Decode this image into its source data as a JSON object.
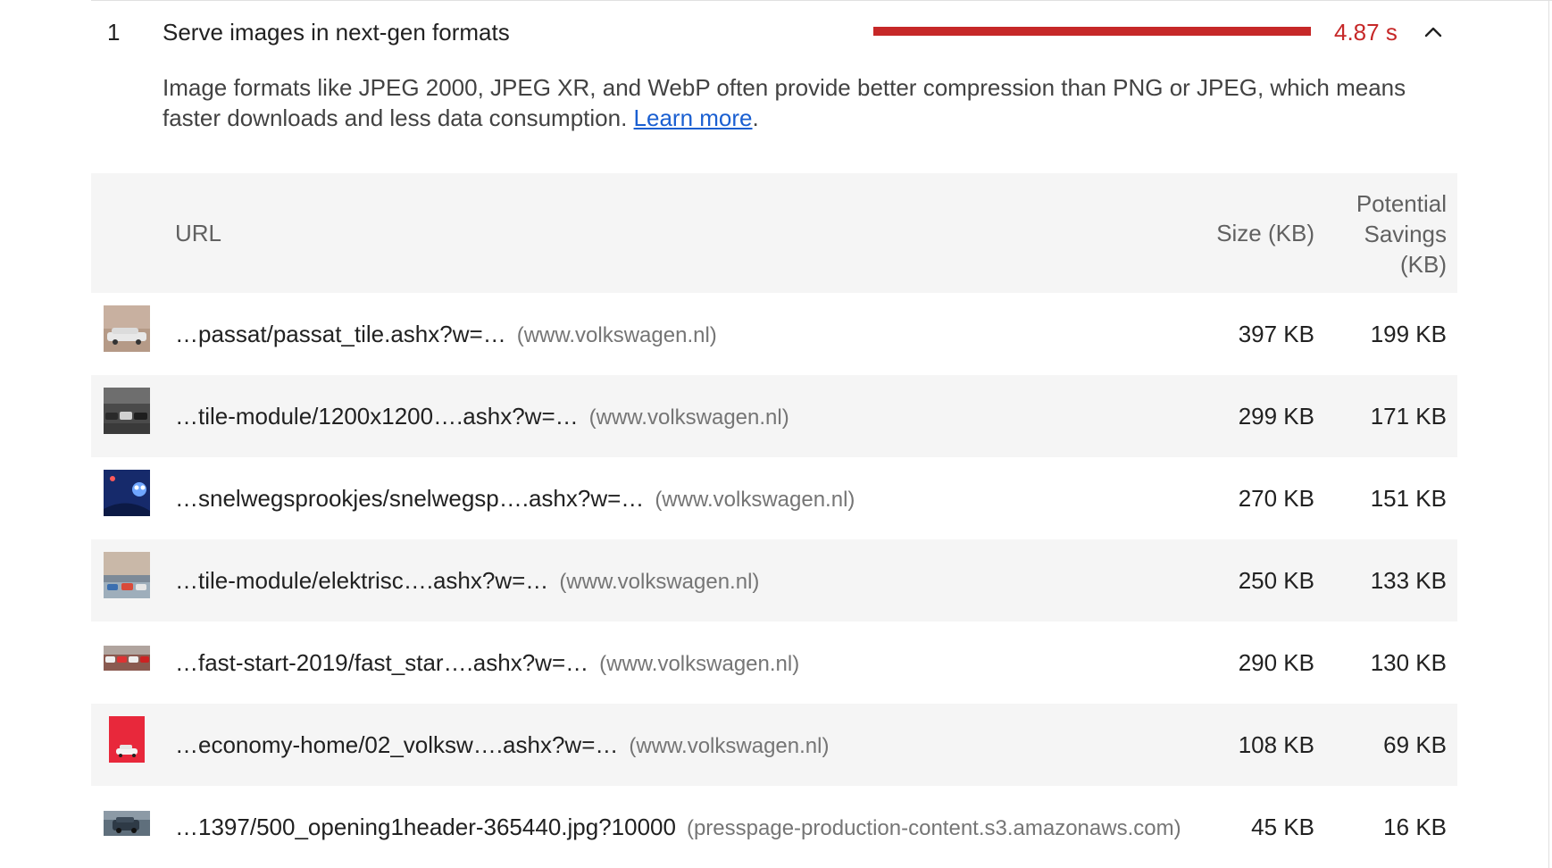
{
  "audit": {
    "index": "1",
    "title": "Serve images in next-gen formats",
    "savings_value": "4.87 s",
    "savings_fraction": 1.0,
    "status_color": "#c62828",
    "toggle_icon": "chevron-up-icon",
    "description_text": "Image formats like JPEG 2000, JPEG XR, and WebP often provide better compression than PNG or JPEG, which means faster downloads and less data consumption. ",
    "learn_more_label": "Learn more",
    "description_end": "."
  },
  "table": {
    "headers": {
      "url": "URL",
      "size": "Size (KB)",
      "savings": "Potential Savings (KB)"
    },
    "rows": [
      {
        "url": "…passat/passat_tile.ashx?w=…",
        "host": "(www.volkswagen.nl)",
        "size": "397 KB",
        "savings": "199 KB",
        "thumb": "car-photo-thumbnail"
      },
      {
        "url": "…tile-module/1200x1200….ashx?w=…",
        "host": "(www.volkswagen.nl)",
        "size": "299 KB",
        "savings": "171 KB",
        "thumb": "cars-lineup-thumbnail"
      },
      {
        "url": "…snelwegsprookjes/snelwegsp….ashx?w=…",
        "host": "(www.volkswagen.nl)",
        "size": "270 KB",
        "savings": "151 KB",
        "thumb": "night-illustration-thumbnail"
      },
      {
        "url": "…tile-module/elektrisc….ashx?w=…",
        "host": "(www.volkswagen.nl)",
        "size": "250 KB",
        "savings": "133 KB",
        "thumb": "city-cars-thumbnail"
      },
      {
        "url": "…fast-start-2019/fast_star….ashx?w=…",
        "host": "(www.volkswagen.nl)",
        "size": "290 KB",
        "savings": "130 KB",
        "thumb": "car-row-thumbnail"
      },
      {
        "url": "…economy-home/02_volksw….ashx?w=…",
        "host": "(www.volkswagen.nl)",
        "size": "108 KB",
        "savings": "69 KB",
        "thumb": "red-car-thumbnail"
      },
      {
        "url": "…1397/500_opening1header-365440.jpg?10000",
        "host": "(presspage-production-content.s3.amazonaws.com)",
        "size": "45 KB",
        "savings": "16 KB",
        "thumb": "suv-thumbnail"
      }
    ]
  }
}
